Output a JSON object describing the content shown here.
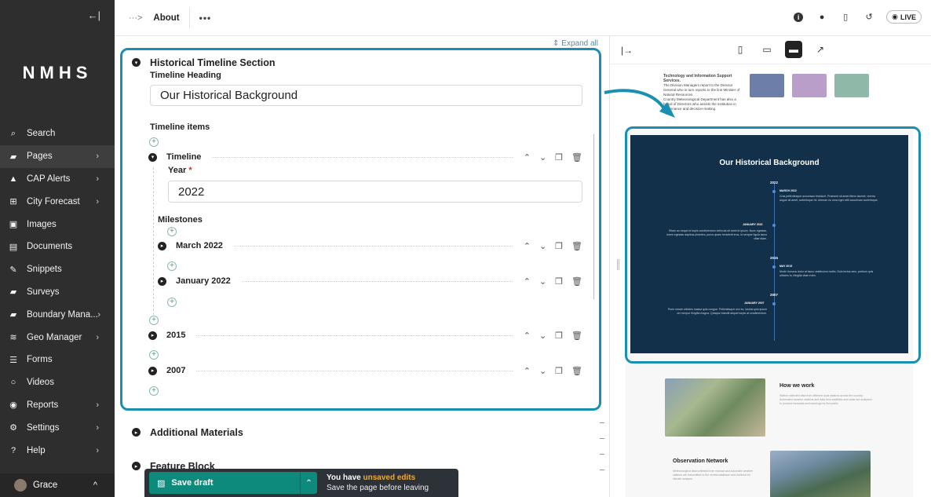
{
  "sidebar": {
    "collapse_icon": "arrow-left-bar-icon",
    "logo": "NMHS",
    "items": [
      {
        "label": "Search",
        "icon": "search-icon",
        "chevron": ""
      },
      {
        "label": "Pages",
        "icon": "folder-icon",
        "chevron": "›"
      },
      {
        "label": "CAP Alerts",
        "icon": "warning-icon",
        "chevron": "›"
      },
      {
        "label": "City Forecast",
        "icon": "table-icon",
        "chevron": "›"
      },
      {
        "label": "Images",
        "icon": "image-icon",
        "chevron": ""
      },
      {
        "label": "Documents",
        "icon": "document-icon",
        "chevron": ""
      },
      {
        "label": "Snippets",
        "icon": "snippet-icon",
        "chevron": ""
      },
      {
        "label": "Surveys",
        "icon": "folder-icon",
        "chevron": ""
      },
      {
        "label": "Boundary Mana...",
        "icon": "folder-icon",
        "chevron": "›"
      },
      {
        "label": "Geo Manager",
        "icon": "layers-icon",
        "chevron": "›"
      },
      {
        "label": "Forms",
        "icon": "form-icon",
        "chevron": ""
      },
      {
        "label": "Videos",
        "icon": "circle-icon",
        "chevron": ""
      },
      {
        "label": "Reports",
        "icon": "reports-icon",
        "chevron": "›"
      },
      {
        "label": "Settings",
        "icon": "cog-icon",
        "chevron": "›"
      },
      {
        "label": "Help",
        "icon": "help-icon",
        "chevron": "›"
      }
    ],
    "user": {
      "name": "Grace",
      "chevron": "^"
    }
  },
  "topbar": {
    "crumb_arrow": "···>",
    "page": "About",
    "more": "•••",
    "live_label": "LIVE"
  },
  "editor": {
    "expand_all": "Expand all",
    "timeline_section": "Historical Timeline Section",
    "timeline_heading_label": "Timeline Heading",
    "timeline_heading_value": "Our Historical Background",
    "timeline_items_label": "Timeline items",
    "timeline_block_label": "Timeline",
    "year_label": "Year",
    "year_required": "*",
    "year_value": "2022",
    "milestones_label": "Milestones",
    "milestones": [
      "March 2022",
      "January 2022"
    ],
    "other_years": [
      "2015",
      "2007"
    ],
    "additional_materials": "Additional Materials",
    "feature_block": "Feature Block"
  },
  "savebar": {
    "save_label": "Save draft",
    "msg_prefix": "You have ",
    "msg_warn": "unsaved edits",
    "msg_line2": "Save the page before leaving"
  },
  "preview": {
    "top_text_title": "Technology and Information Support Services.",
    "top_text_body": "The Division Managers report to the Director General who in turn reports to the line Minister of Natural Resources.",
    "top_text_body2": "Country Meteorological Department has also a board of Directors who assists the institution in governance and decision-making.",
    "timeline_title": "Our Historical Background",
    "years": [
      {
        "year": "2022",
        "milestones": [
          {
            "title": "MARCH 2022",
            "side": "right",
            "text": "Cras pellentesque accumsan tincidunt. Praesent sit amet libero laoreet, viverra augue sit amet, scelerisque mi. Aenean eu urna eget velit accumsan scelerisque."
          },
          {
            "title": "JANUARY 2022",
            "side": "left",
            "text": "Etiam ac neque id turpis condimentum vehicula sit amet id ipsum. Nunc egestas, lorem egestas dapibus pharetra, purus quam hendrerit eros, id semper ligula lacus vitae diam."
          }
        ]
      },
      {
        "year": "2015",
        "milestones": [
          {
            "title": "MAY 2015",
            "side": "right",
            "text": "Morbi rhoncus dolor at lacus vestibulum mollis. Duis lectus sem, pretium quis ultricies in, fringilla vitae enim."
          }
        ]
      },
      {
        "year": "2007",
        "milestones": [
          {
            "title": "JANUARY 2007",
            "side": "left",
            "text": "Proin ornare ultricies massa quis congue. Pellentesque orci ex, lacinia quis ipsum vel, tempor fringilla magna. Quisque blandit aliquet turpis at condimentum."
          }
        ]
      }
    ],
    "how_title": "How we work",
    "how_text": "Station collected data from different local stations across the country. Automated weather stations and data from satellites and radar are analysed to produce forecasts and warnings for the public.",
    "obs_title": "Observation Network",
    "obs_text": "Meteorological data collected from manual and automatic weather stations are transmitted to the central database and archived for climate analysis."
  },
  "colors": {
    "accent": "#1b8fb0",
    "sidebar_bg": "#2e2e2e",
    "save_green": "#0e8a7c",
    "timeline_bg": "#13304a",
    "warn": "#f0a830"
  }
}
